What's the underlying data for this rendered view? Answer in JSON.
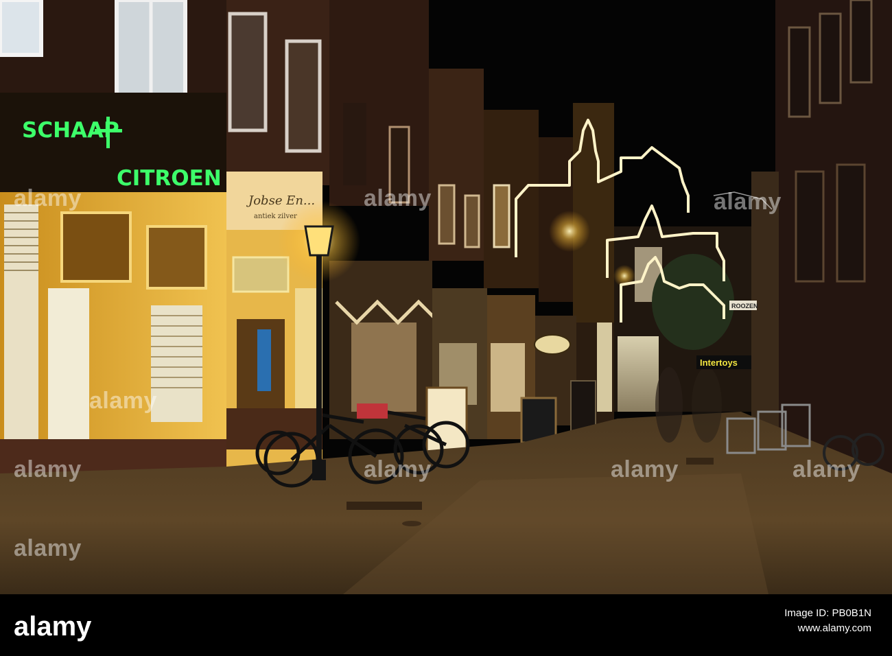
{
  "scene": {
    "shop_sign": "SCHAAP + CITROEN",
    "shop_sign_left": "SCHAAP",
    "shop_sign_right": "CITROEN",
    "antique_sign": "Jobse En...",
    "antique_sub": "antiek zilver",
    "toy_store_sign": "Intertoys",
    "roozen_sign": "ROOZEN",
    "colors": {
      "neon_green": "#3dff6a",
      "lamp_yellow": "#ffd24a",
      "storefront_glow": "#e8b230",
      "pavement": "#5a4426",
      "night_sky": "#040404"
    }
  },
  "watermarks": {
    "text": "alamy"
  },
  "stock_bar": {
    "logo": "alamy",
    "image_id": "Image ID: PB0B1N",
    "url": "www.alamy.com"
  }
}
